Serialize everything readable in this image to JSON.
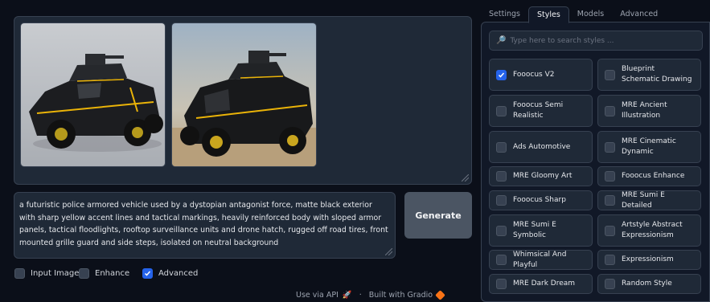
{
  "gallery": {
    "images": [
      {
        "alt_name": "armored-vehicle-image-1"
      },
      {
        "alt_name": "armored-vehicle-image-2"
      }
    ]
  },
  "prompt": {
    "value": "a futuristic police armored vehicle used by a dystopian antagonist force, matte black exterior with sharp yellow accent lines and tactical markings, heavily reinforced body with sloped armor panels, tactical floodlights, rooftop surveillance units and drone hatch, rugged off road tires, front mounted grille guard and side steps, isolated on neutral background"
  },
  "generate_label": "Generate",
  "options": [
    {
      "label": "Input Image",
      "checked": false
    },
    {
      "label": "Enhance",
      "checked": false
    },
    {
      "label": "Advanced",
      "checked": true
    }
  ],
  "footer": {
    "api_label": "Use via API",
    "separator": "·",
    "built_label": "Built with Gradio"
  },
  "tabs": [
    "Settings",
    "Styles",
    "Models",
    "Advanced"
  ],
  "active_tab": "Styles",
  "search": {
    "placeholder": "Type here to search styles ..."
  },
  "styles": [
    {
      "label": "Fooocus V2",
      "checked": true
    },
    {
      "label": "Blueprint Schematic Drawing",
      "checked": false
    },
    {
      "label": "Fooocus Semi Realistic",
      "checked": false
    },
    {
      "label": "MRE Ancient Illustration",
      "checked": false
    },
    {
      "label": "Ads Automotive",
      "checked": false
    },
    {
      "label": "MRE Cinematic Dynamic",
      "checked": false
    },
    {
      "label": "MRE Gloomy Art",
      "checked": false
    },
    {
      "label": "Fooocus Enhance",
      "checked": false
    },
    {
      "label": "Fooocus Sharp",
      "checked": false
    },
    {
      "label": "MRE Sumi E Detailed",
      "checked": false
    },
    {
      "label": "MRE Sumi E Symbolic",
      "checked": false
    },
    {
      "label": "Artstyle Abstract Expressionism",
      "checked": false
    },
    {
      "label": "Whimsical And Playful",
      "checked": false
    },
    {
      "label": "Expressionism",
      "checked": false
    },
    {
      "label": "MRE Dark Dream",
      "checked": false
    },
    {
      "label": "Random Style",
      "checked": false
    }
  ],
  "colors": {
    "accent": "#2563eb",
    "background": "#0b0f19",
    "panel": "#1f2937",
    "vehicle_stripe": "#eab308"
  }
}
